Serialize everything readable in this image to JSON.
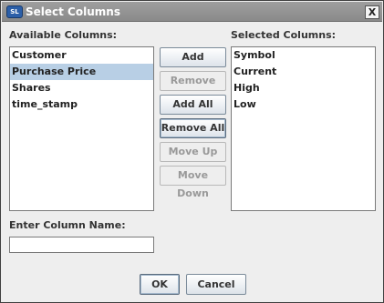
{
  "window": {
    "title": "Select Columns",
    "app_icon_text": "SL",
    "close_label": "X"
  },
  "available": {
    "label": "Available Columns:",
    "items": [
      "Customer",
      "Purchase Price",
      "Shares",
      "time_stamp"
    ],
    "selected_index": 1
  },
  "selected": {
    "label": "Selected Columns:",
    "items": [
      "Symbol",
      "Current",
      "High",
      "Low"
    ]
  },
  "buttons": {
    "add": "Add",
    "remove": "Remove",
    "add_all": "Add All",
    "remove_all": "Remove All",
    "move_up": "Move Up",
    "move_down": "Move Down",
    "ok": "OK",
    "cancel": "Cancel"
  },
  "column_name": {
    "label": "Enter Column Name:",
    "value": ""
  }
}
